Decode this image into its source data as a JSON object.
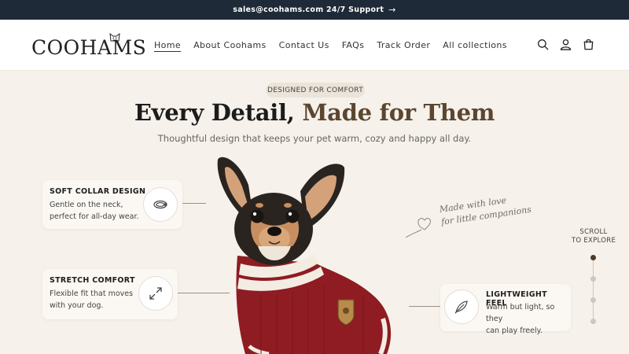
{
  "announcement": {
    "text": "sales@coohams.com 24/7 Support",
    "arrow": "→"
  },
  "brand": {
    "logo_text": "COOHAMS"
  },
  "nav": {
    "items": [
      {
        "label": "Home",
        "active": true
      },
      {
        "label": "About Coohams"
      },
      {
        "label": "Contact Us"
      },
      {
        "label": "FAQs"
      },
      {
        "label": "Track Order"
      },
      {
        "label": "All collections"
      }
    ]
  },
  "header_icons": [
    "search-icon",
    "account-icon",
    "cart-icon"
  ],
  "hero": {
    "badge": "DESIGNED FOR COMFORT",
    "title_part1": "Every Detail, ",
    "title_part2": "Made for Them",
    "subtitle": "Thoughtful design that keeps your pet warm, cozy and happy all day."
  },
  "features": [
    {
      "title": "SOFT COLLAR DESIGN",
      "desc1": "Gentle on the neck,",
      "desc2": "perfect for all-day wear.",
      "icon": "collar-icon"
    },
    {
      "title": "STRETCH COMFORT",
      "desc1": "Flexible fit that moves",
      "desc2": "with your dog.",
      "icon": "stretch-icon"
    },
    {
      "title": "LIGHTWEIGHT FEEL",
      "desc1": "Warm but light, so they",
      "desc2": "can play freely.",
      "icon": "feather-icon"
    }
  ],
  "script_note": {
    "line1": "Made with love",
    "line2": "for little companions"
  },
  "scroll": {
    "line1": "SCROLL",
    "line2": "TO EXPLORE",
    "active_index": 0,
    "count": 4
  },
  "colors": {
    "announcement_bg": "#1f2a38",
    "accent": "#5b4630",
    "page_bg": "#f6f1ea",
    "sweater": "#8e1c22"
  }
}
